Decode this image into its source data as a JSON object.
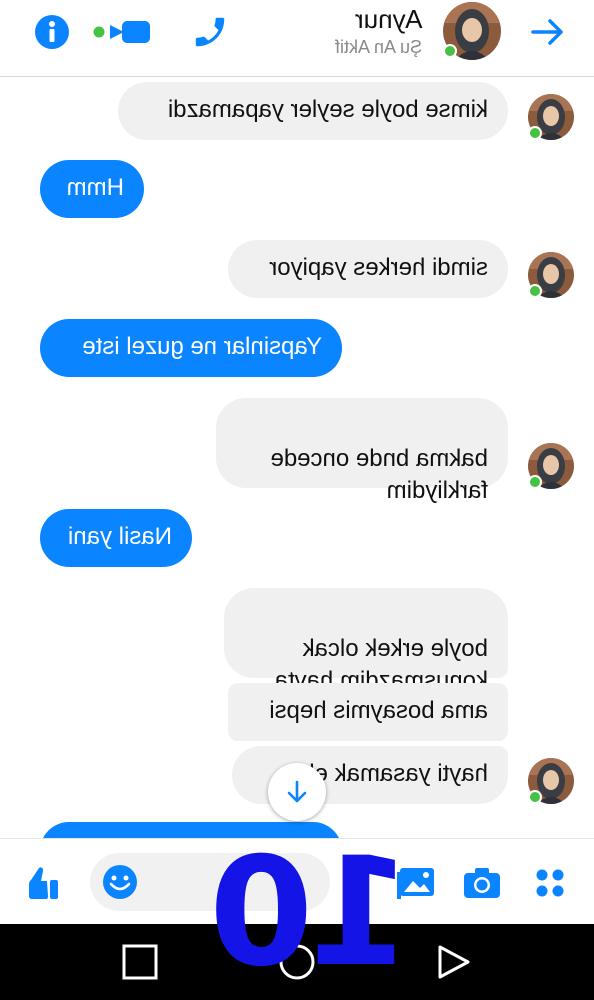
{
  "header": {
    "contact_name": "Aynur",
    "status": "Şu An Aktif",
    "icons": [
      "info-icon",
      "video-call-icon",
      "phone-icon",
      "send-arrow-icon"
    ]
  },
  "messages": [
    {
      "from": "contact",
      "text": "kimse boyle seyler yapamazdi"
    },
    {
      "from": "me",
      "text": "Hmm"
    },
    {
      "from": "contact",
      "text": "simdi herkes yapiyor"
    },
    {
      "from": "me",
      "text": "Yapsinlar ne guzel iste"
    },
    {
      "from": "contact",
      "text": "bakma bnde oncede\nfarkliydim"
    },
    {
      "from": "me",
      "text": "Nasil yani"
    },
    {
      "from": "contact",
      "text": "boyle erkek olcak\nkonusmazdim hayta"
    },
    {
      "from": "contact",
      "text": "ama bosaymis hepsi"
    },
    {
      "from": "contact",
      "text": "hayti yasamak el"
    }
  ],
  "composer": {
    "icons": [
      "like-icon",
      "emoji-icon",
      "image-icon",
      "camera-icon",
      "more-icon"
    ]
  },
  "overlay_number": "10",
  "navbar": {
    "buttons": [
      "recents-icon",
      "home-icon",
      "back-icon"
    ]
  },
  "colors": {
    "accent": "#0A84FF",
    "received_bubble": "#F0F0F0",
    "online": "#44C244",
    "overlay": "#1414E6"
  }
}
